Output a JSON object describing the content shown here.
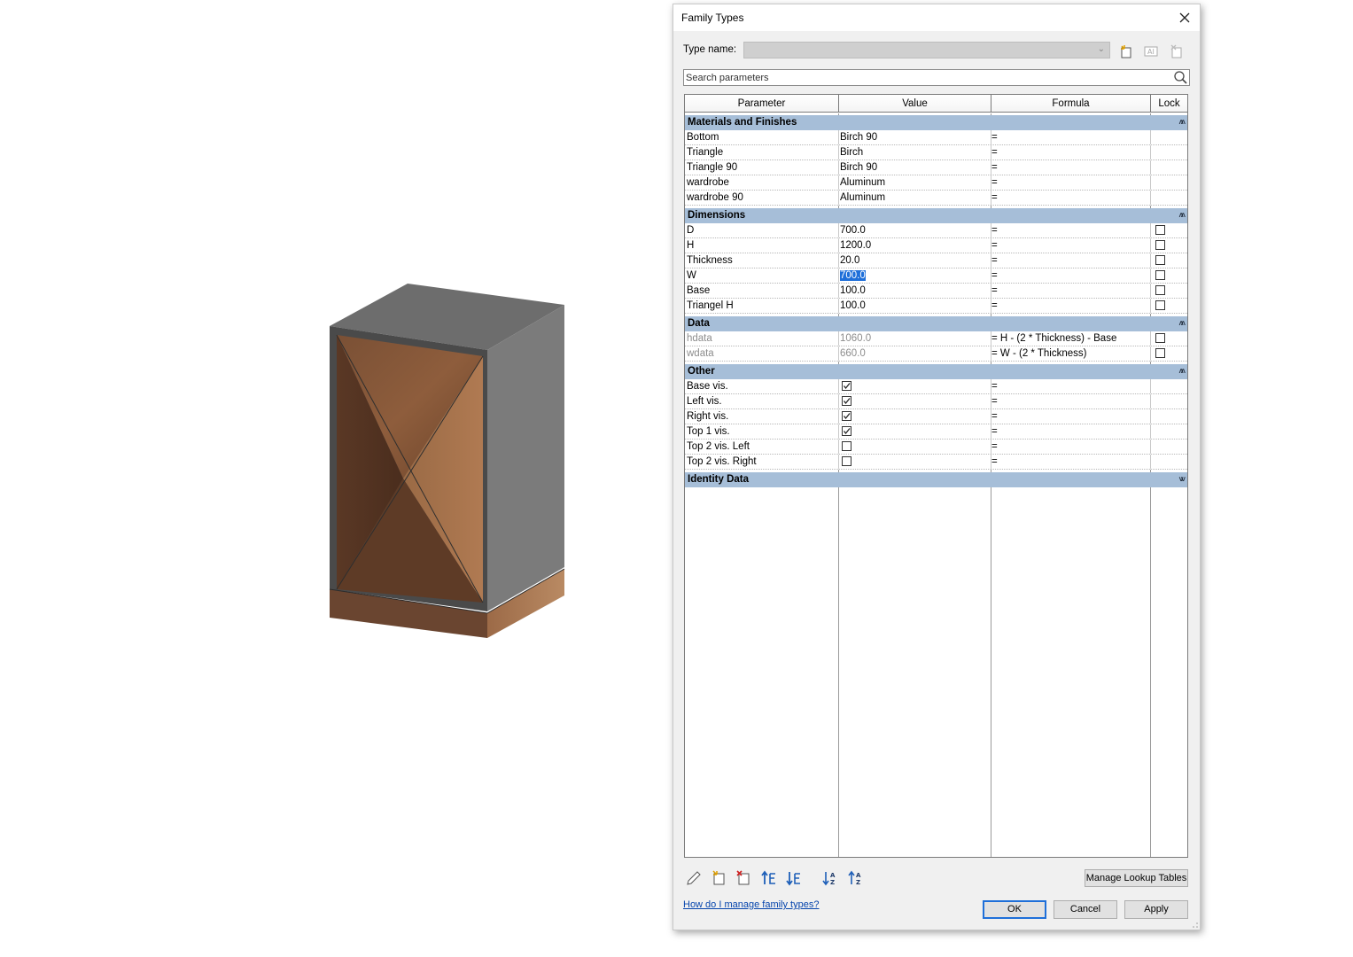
{
  "dialog": {
    "title": "Family Types",
    "type_name_label": "Type name:",
    "type_name_value": "",
    "search_placeholder": "Search parameters",
    "columns": {
      "parameter": "Parameter",
      "value": "Value",
      "formula": "Formula",
      "lock": "Lock"
    },
    "groups": [
      {
        "name": "Materials and Finishes",
        "collapsed": false,
        "rows": [
          {
            "param": "Bottom",
            "value": "Birch 90",
            "formula": "=",
            "lock": null
          },
          {
            "param": "Triangle",
            "value": "Birch",
            "formula": "=",
            "lock": null
          },
          {
            "param": "Triangle 90",
            "value": "Birch 90",
            "formula": "=",
            "lock": null
          },
          {
            "param": "wardrobe",
            "value": "Aluminum",
            "formula": "=",
            "lock": null
          },
          {
            "param": "wardrobe 90",
            "value": "Aluminum",
            "formula": "=",
            "lock": null
          }
        ]
      },
      {
        "name": "Dimensions",
        "collapsed": false,
        "rows": [
          {
            "param": "D",
            "value": "700.0",
            "formula": "=",
            "lock": false
          },
          {
            "param": "H",
            "value": "1200.0",
            "formula": "=",
            "lock": false
          },
          {
            "param": "Thickness",
            "value": "20.0",
            "formula": "=",
            "lock": false
          },
          {
            "param": "W",
            "value": "700.0",
            "formula": "=",
            "lock": false,
            "selected": true
          },
          {
            "param": "Base",
            "value": "100.0",
            "formula": "=",
            "lock": false
          },
          {
            "param": "Triangel H",
            "value": "100.0",
            "formula": "=",
            "lock": false
          }
        ]
      },
      {
        "name": "Data",
        "collapsed": false,
        "rows": [
          {
            "param": "hdata",
            "value": "1060.0",
            "formula": "= H - (2 * Thickness) - Base",
            "lock": false,
            "disabled": true
          },
          {
            "param": "wdata",
            "value": "660.0",
            "formula": "= W - (2 * Thickness)",
            "lock": false,
            "disabled": true
          }
        ]
      },
      {
        "name": "Other",
        "collapsed": false,
        "rows": [
          {
            "param": "Base vis.",
            "checkbox": true,
            "formula": "=",
            "lock": null
          },
          {
            "param": "Left vis.",
            "checkbox": true,
            "formula": "=",
            "lock": null
          },
          {
            "param": "Right vis.",
            "checkbox": true,
            "formula": "=",
            "lock": null
          },
          {
            "param": "Top 1 vis.",
            "checkbox": true,
            "formula": "=",
            "lock": null
          },
          {
            "param": "Top 2 vis. Left",
            "checkbox": false,
            "formula": "=",
            "lock": null
          },
          {
            "param": "Top 2 vis. Right",
            "checkbox": false,
            "formula": "=",
            "lock": null
          }
        ]
      },
      {
        "name": "Identity Data",
        "collapsed": true,
        "rows": []
      }
    ],
    "toolbar_icons": [
      "pencil-icon",
      "new-parameter-icon",
      "delete-parameter-icon",
      "move-up-icon",
      "move-down-icon",
      "sort-ascending-icon",
      "sort-descending-icon"
    ],
    "manage_lookup_label": "Manage Lookup Tables",
    "help_link": "How do I manage family types?",
    "ok_label": "OK",
    "cancel_label": "Cancel",
    "apply_label": "Apply"
  },
  "colors": {
    "group_header": "#a6bed8",
    "selection": "#1e6fd9",
    "wood": "#7a4e30",
    "frame": "#6a6a6a"
  }
}
